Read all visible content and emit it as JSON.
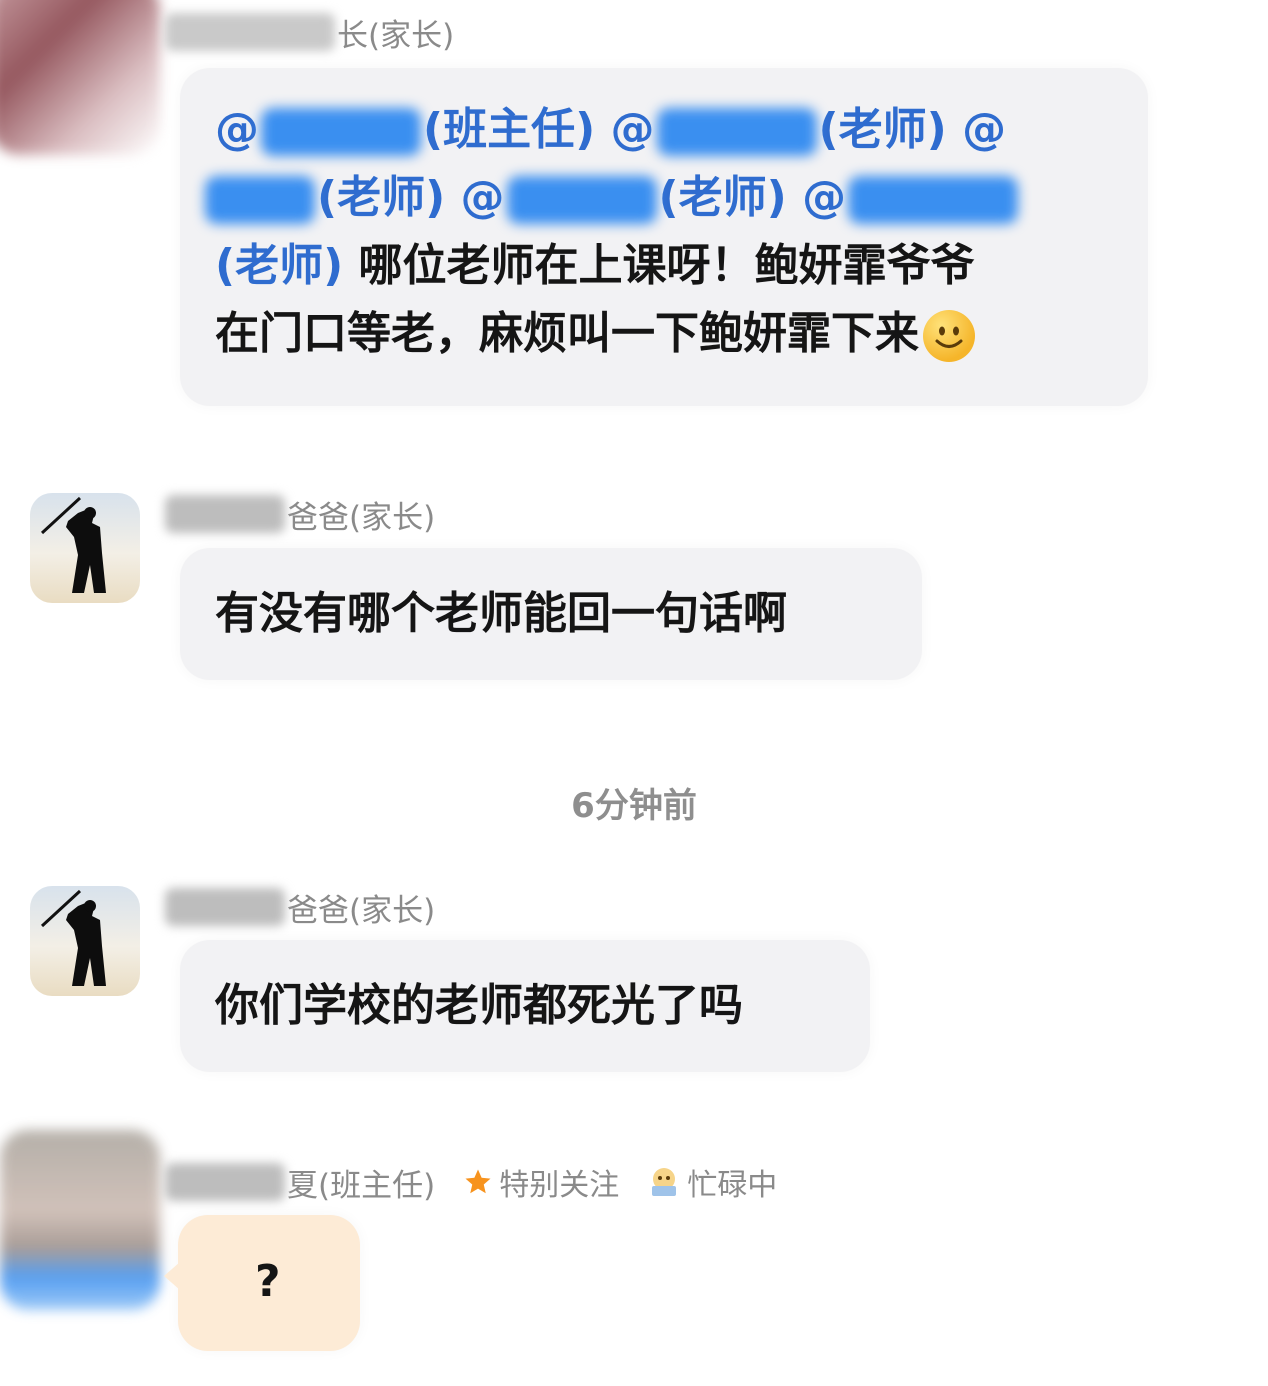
{
  "messages": [
    {
      "sender_suffix": "长(家长)",
      "lines": [
        {
          "parts": [
            {
              "t": "@",
              "c": "m"
            },
            {
              "t": "blur"
            },
            {
              "t": "(班主任) @",
              "c": "m"
            },
            {
              "t": "blur"
            },
            {
              "t": "(老师) @",
              "c": "m"
            }
          ]
        },
        {
          "parts": [
            {
              "t": "blur"
            },
            {
              "t": "(老师) @",
              "c": "m"
            },
            {
              "t": "blur"
            },
            {
              "t": "(老师) @",
              "c": "m"
            },
            {
              "t": "blur"
            }
          ]
        },
        {
          "parts": [
            {
              "t": "(老师)",
              "c": "m"
            },
            {
              "t": " 哪位老师在上课呀！鲍妍霏爷爷",
              "c": "n"
            }
          ]
        },
        {
          "parts": [
            {
              "t": "在门口等老，麻烦叫一下鲍妍霏下来",
              "c": "n"
            }
          ]
        }
      ]
    },
    {
      "sender_suffix": "爸爸(家长)",
      "text": "有没有哪个老师能回一句话啊"
    },
    {
      "sender_suffix": "爸爸(家长)",
      "text": "你们学校的老师都死光了吗"
    },
    {
      "sender_suffix": "夏(班主任)",
      "badge_follow": "特别关注",
      "badge_busy": "忙碌中",
      "text": "?"
    }
  ],
  "timestamp": "6分钟前",
  "colors": {
    "mention": "#2f6ccf",
    "bubble_gray": "#f2f2f4",
    "bubble_peach": "#fdebd6",
    "star": "#f7931e"
  },
  "icons": {
    "emoji": "smile-emoji-icon",
    "star": "star-icon",
    "busy": "busy-status-icon"
  }
}
